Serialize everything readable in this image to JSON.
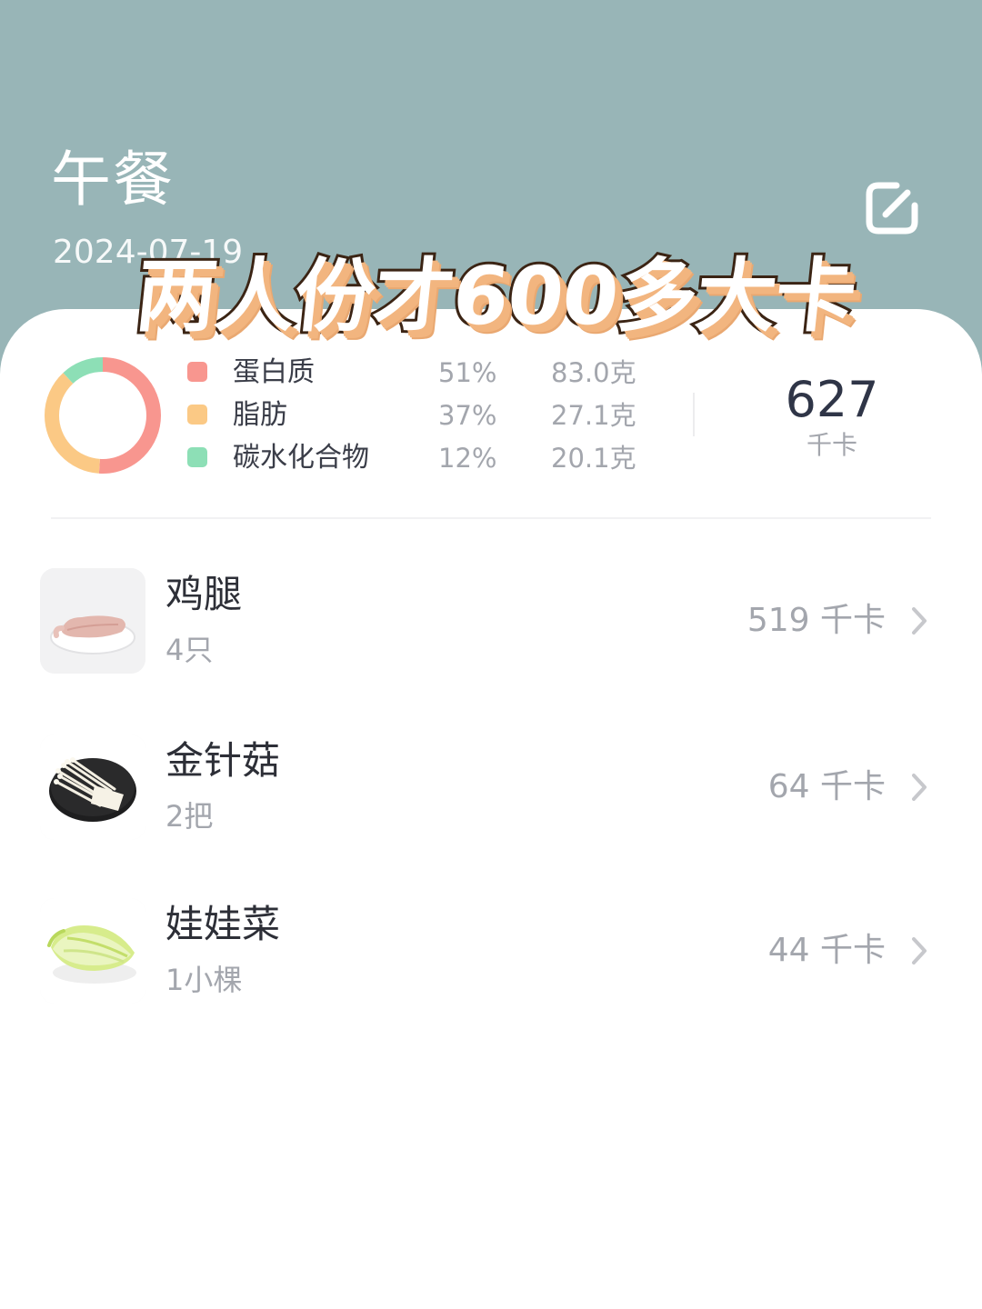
{
  "header": {
    "meal": "午餐",
    "date": "2024-07-19",
    "background": "#98b5b7"
  },
  "overlay_text": "两人份才600多大卡",
  "macros": [
    {
      "name": "蛋白质",
      "percent": "51%",
      "amount": "83.0克",
      "color": "#f8968f",
      "share": 0.51
    },
    {
      "name": "脂肪",
      "percent": "37%",
      "amount": "27.1克",
      "color": "#fbc985",
      "share": 0.37
    },
    {
      "name": "碳水化合物",
      "percent": "12%",
      "amount": "20.1克",
      "color": "#8ddfb6",
      "share": 0.12
    }
  ],
  "total": {
    "value": "627",
    "unit": "千卡"
  },
  "foods": [
    {
      "name": "鸡腿",
      "qty": "4只",
      "cal": "519 千卡",
      "icon": "chicken-leg-photo"
    },
    {
      "name": "金针菇",
      "qty": "2把",
      "cal": "64 千卡",
      "icon": "enoki-mushroom-photo"
    },
    {
      "name": "娃娃菜",
      "qty": "1小棵",
      "cal": "44 千卡",
      "icon": "baby-cabbage-photo"
    }
  ],
  "icons": {
    "edit": "edit-icon",
    "chevron": "chevron-right-icon"
  }
}
